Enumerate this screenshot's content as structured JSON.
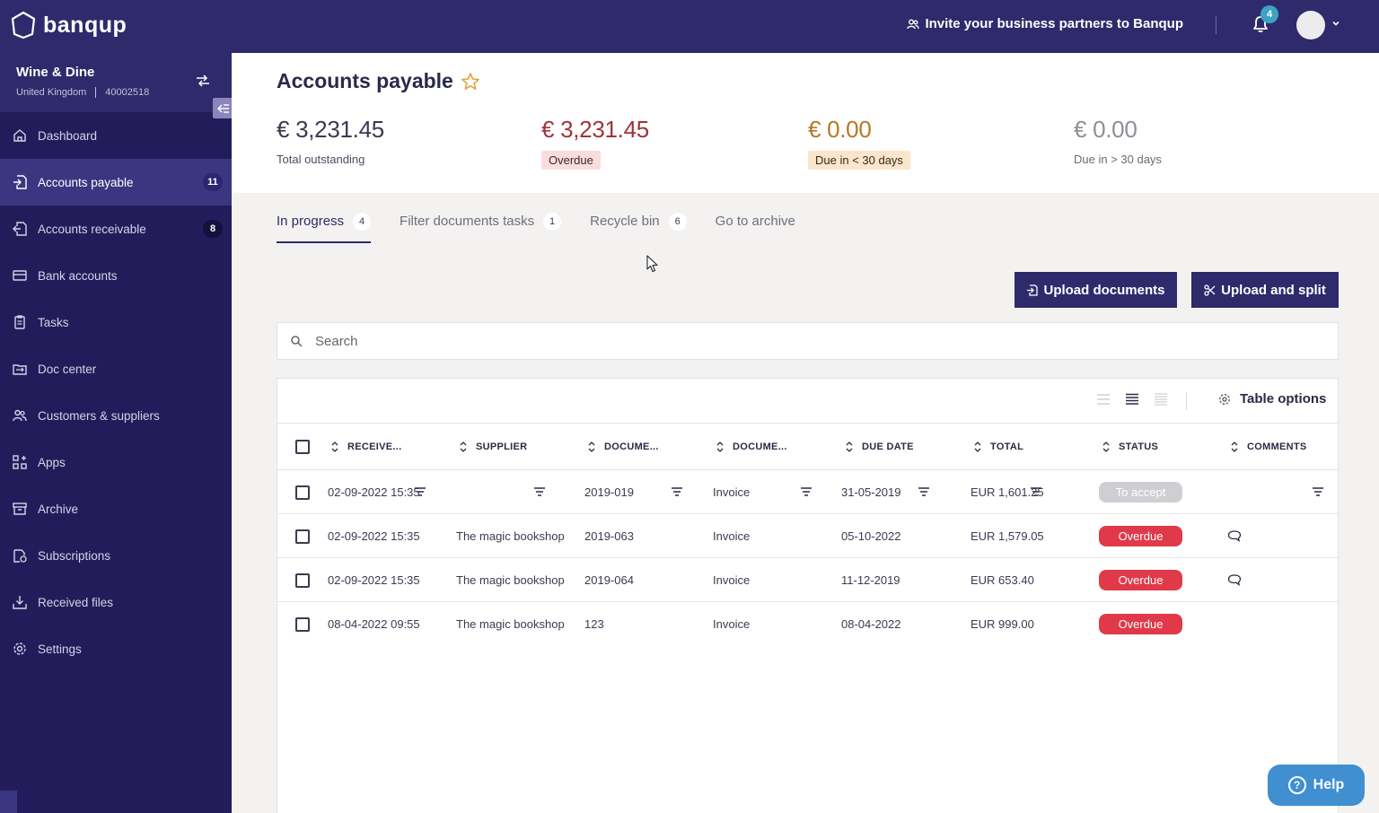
{
  "app": {
    "brand": "banqup"
  },
  "topbar": {
    "invite_label": "Invite your business partners to Banqup",
    "notifications_count": "4"
  },
  "sidebar": {
    "company_name": "Wine & Dine",
    "company_country": "United Kingdom",
    "company_id": "40002518",
    "items": [
      {
        "label": "Dashboard",
        "icon": "home-icon"
      },
      {
        "label": "Accounts payable",
        "icon": "incoming-doc-icon",
        "count": "11",
        "active": true
      },
      {
        "label": "Accounts receivable",
        "icon": "outgoing-doc-icon",
        "count": "8"
      },
      {
        "label": "Bank accounts",
        "icon": "card-icon"
      },
      {
        "label": "Tasks",
        "icon": "clipboard-icon"
      },
      {
        "label": "Doc center",
        "icon": "doc-center-icon"
      },
      {
        "label": "Customers & suppliers",
        "icon": "people-icon"
      },
      {
        "label": "Apps",
        "icon": "apps-icon"
      },
      {
        "label": "Archive",
        "icon": "archive-icon"
      },
      {
        "label": "Subscriptions",
        "icon": "subscriptions-icon"
      },
      {
        "label": "Received files",
        "icon": "download-icon"
      },
      {
        "label": "Settings",
        "icon": "gear-icon"
      }
    ]
  },
  "page": {
    "title": "Accounts payable",
    "stats": [
      {
        "amount": "€ 3,231.45",
        "label": "Total outstanding"
      },
      {
        "amount": "€ 3,231.45",
        "label": "Overdue"
      },
      {
        "amount": "€ 0.00",
        "label": "Due in < 30 days"
      },
      {
        "amount": "€ 0.00",
        "label": "Due in > 30 days"
      }
    ]
  },
  "tabs": [
    {
      "label": "In progress",
      "count": "4",
      "active": true
    },
    {
      "label": "Filter documents tasks",
      "count": "1"
    },
    {
      "label": "Recycle bin",
      "count": "6"
    },
    {
      "label": "Go to archive"
    }
  ],
  "actions": {
    "upload_label": "Upload documents",
    "split_label": "Upload and split"
  },
  "search": {
    "placeholder": "Search"
  },
  "table": {
    "options_label": "Table options",
    "columns": [
      "RECEIVE...",
      "SUPPLIER",
      "DOCUME...",
      "DOCUME...",
      "DUE DATE",
      "TOTAL",
      "STATUS",
      "COMMENTS"
    ],
    "rows": [
      {
        "received": "02-09-2022 15:35",
        "supplier": "",
        "doc_number": "2019-019",
        "doc_type": "Invoice",
        "due_date": "31-05-2019",
        "total": "EUR 1,601.25",
        "status": "To accept",
        "has_comment": false
      },
      {
        "received": "02-09-2022 15:35",
        "supplier": "The magic bookshop",
        "doc_number": "2019-063",
        "doc_type": "Invoice",
        "due_date": "05-10-2022",
        "total": "EUR 1,579.05",
        "status": "Overdue",
        "has_comment": true
      },
      {
        "received": "02-09-2022 15:35",
        "supplier": "The magic bookshop",
        "doc_number": "2019-064",
        "doc_type": "Invoice",
        "due_date": "11-12-2019",
        "total": "EUR 653.40",
        "status": "Overdue",
        "has_comment": true
      },
      {
        "received": "08-04-2022 09:55",
        "supplier": "The magic bookshop",
        "doc_number": "123",
        "doc_type": "Invoice",
        "due_date": "08-04-2022",
        "total": "EUR 999.00",
        "status": "Overdue",
        "has_comment": false
      }
    ]
  },
  "help": {
    "label": "Help"
  },
  "colors": {
    "brand_dark": "#2e2a6b",
    "sidebar_bg": "#221d5a",
    "overdue_red": "#e03a4a",
    "help_blue": "#3f8fd1"
  }
}
